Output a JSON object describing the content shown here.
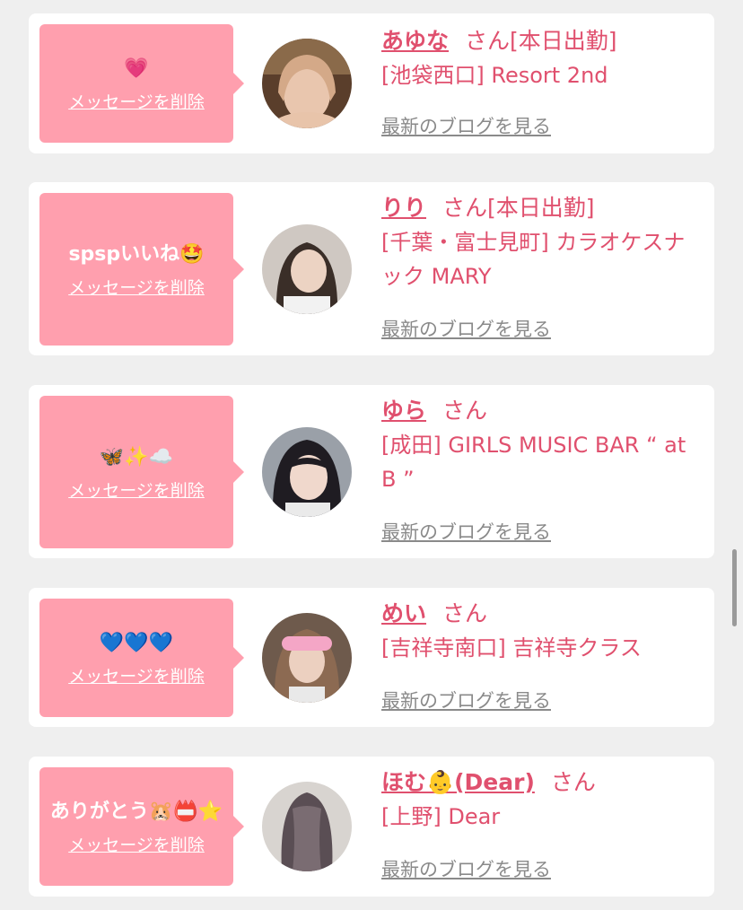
{
  "colors": {
    "accent": "#e0506e",
    "bubble": "#ff9fae",
    "muted": "#8a8a8a",
    "background": "#efefef"
  },
  "items": [
    {
      "message": "💗",
      "delete_label": "メッセージを削除",
      "name": "あゆな",
      "suffix": "さん[本日出勤]",
      "shop": "[池袋西口] Resort 2nd",
      "blog_label": "最新のブログを見る",
      "avatar": "photo-blonde-woman"
    },
    {
      "message": "spspいいね🤩",
      "delete_label": "メッセージを削除",
      "name": "りり",
      "suffix": "さん[本日出勤]",
      "shop": "[千葉・富士見町] カラオケスナック MARY",
      "blog_label": "最新のブログを見る",
      "avatar": "photo-dark-hair-woman"
    },
    {
      "message": "🦋✨☁️",
      "delete_label": "メッセージを削除",
      "name": "ゆら",
      "suffix": "さん",
      "shop": "[成田] GIRLS MUSIC BAR “ at B ”",
      "blog_label": "最新のブログを見る",
      "avatar": "photo-bob-hair-woman"
    },
    {
      "message": "💙💙💙",
      "delete_label": "メッセージを削除",
      "name": "めい",
      "suffix": "さん",
      "shop": "[吉祥寺南口] 吉祥寺クラス",
      "blog_label": "最新のブログを見る",
      "avatar": "photo-woman-sticker"
    },
    {
      "message": "ありがとう🐹📛⭐",
      "delete_label": "メッセージを削除",
      "name": "ほむ👶(Dear)",
      "suffix": "さん",
      "shop": "[上野] Dear",
      "blog_label": "最新のブログを見る",
      "avatar": "photo-long-hair-back"
    }
  ]
}
